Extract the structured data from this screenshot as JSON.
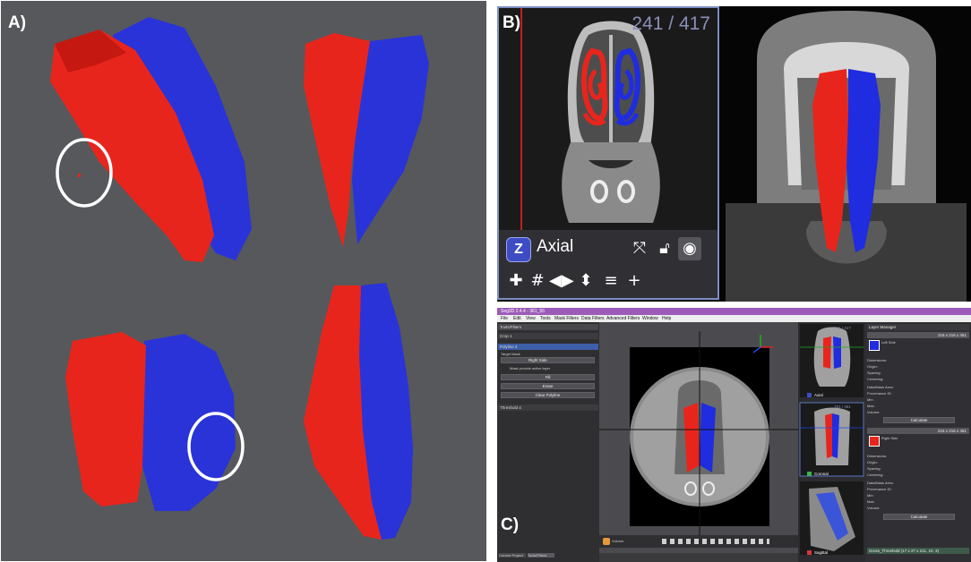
{
  "panels": {
    "a_label": "A)",
    "b_label": "B)",
    "c_label": "C)"
  },
  "colors": {
    "left_label": "#e8251c",
    "right_label": "#1f2ce0",
    "viewport_bg": "#57585b",
    "annotation_circle": "#ffffff"
  },
  "axial_view": {
    "slice_counter": "241 / 417",
    "orientation_badge": "Z",
    "view_name": "Axial",
    "toolbar_icons": [
      "collapse-icon",
      "lock-icon",
      "eye-icon",
      "crosshair-icon",
      "grid-icon",
      "flip-horizontal-icon",
      "flip-vertical-icon",
      "list-icon",
      "plus-icon"
    ]
  },
  "snap_window": {
    "title": "Seg3D 2.4.4 - 361_55",
    "menu": [
      "File",
      "Edit",
      "View",
      "Tools",
      "Mask Filters",
      "Data Filters",
      "Advanced Filters",
      "Window",
      "Help"
    ],
    "left_panel": {
      "header": "Tools/Filters",
      "section_paint": "Crop 1",
      "section_polyline": "Polyline 4",
      "target_label": "Target Mask",
      "target_value": "Right Side",
      "checkbox_label": "Mask provide active layer",
      "buttons": [
        "Fill",
        "Erase",
        "Clear Polyline"
      ],
      "section_threshold": "Threshold 4",
      "bottom_tabs": [
        "Current Project",
        "Tools/Filters"
      ]
    },
    "thumbnails": {
      "axial_counter": "241 / 417",
      "coronal_counter": "191 / 351",
      "axial_label": "Axial",
      "coronal_label": "Coronal",
      "sagittal_label": "Sagittal"
    },
    "view_bar_label": "Volume",
    "layer_manager": {
      "header": "Layer Manager",
      "group1_header": "216 x 216 x 451",
      "layer1_name": "Left Side",
      "group2_header": "216 x 216 x 451",
      "layer2_name": "Right Side",
      "rows": [
        "Dimensions:",
        "Origin:",
        "Spacing:",
        "Centering:",
        "Data/Mask Area:",
        "Provenance ID:",
        "Min:",
        "Max:",
        "Volume:"
      ],
      "calculate": "Calculate",
      "bottom_layer": "Gross_Threshold (17 x 27 x 211, 10, 3)"
    }
  }
}
